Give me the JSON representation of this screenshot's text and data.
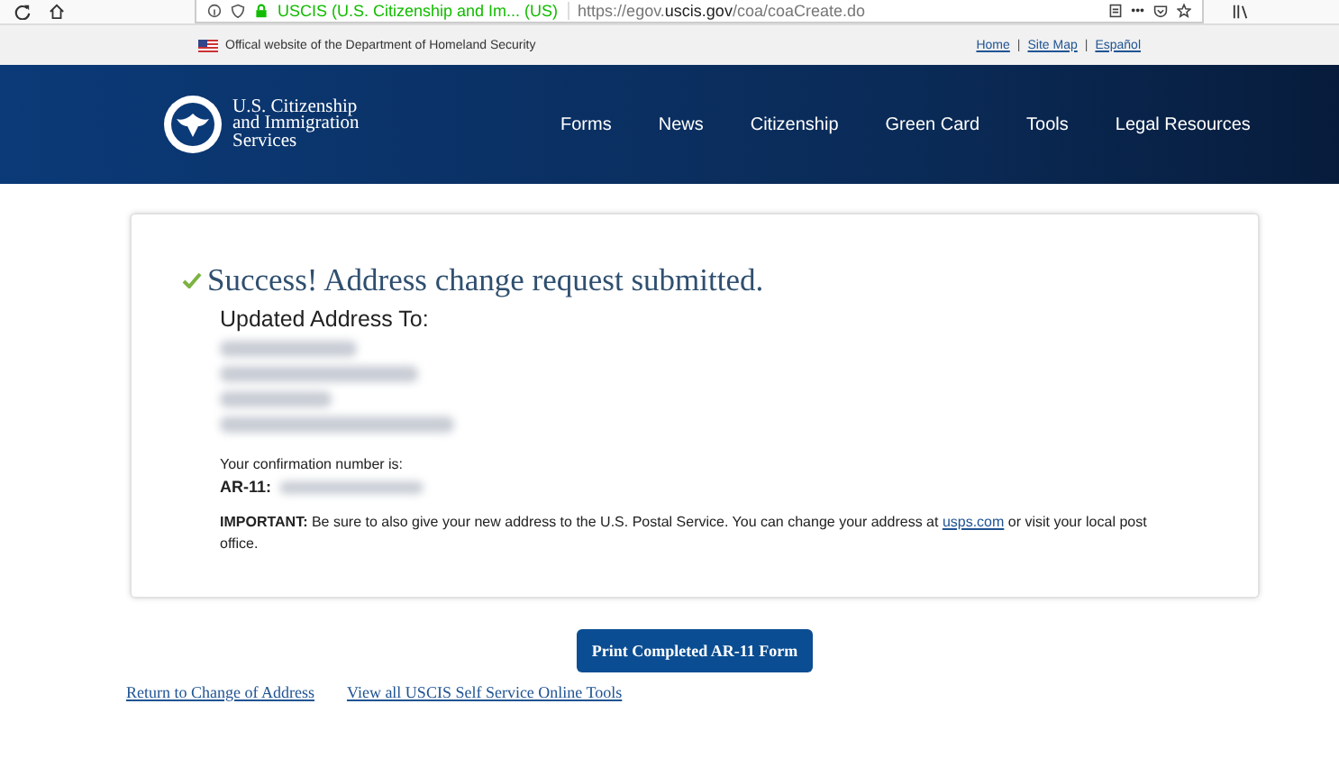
{
  "browser": {
    "site_identity": "USCIS (U.S. Citizenship and Im... (US)",
    "url_prefix": "https://egov.",
    "url_domain": "uscis.gov",
    "url_path": "/coa/coaCreate.do",
    "more": "•••"
  },
  "gov_banner": {
    "text": "Offical website of the Department of Homeland Security",
    "links": [
      "Home",
      "Site Map",
      "Español"
    ],
    "separator": "|"
  },
  "header": {
    "logo_text": [
      "U.S. Citizenship",
      "and Immigration",
      "Services"
    ],
    "nav": [
      "Forms",
      "News",
      "Citizenship",
      "Green Card",
      "Tools",
      "Legal Resources"
    ]
  },
  "result": {
    "title": "Success! Address change request submitted.",
    "address_label": "Updated Address To:",
    "redacted_lines": [
      {
        "kind": "redacted"
      },
      {
        "kind": "redacted"
      },
      {
        "kind": "redacted"
      },
      {
        "kind": "redacted"
      }
    ],
    "confirmation_label": "Your confirmation number is:",
    "ar11_label": "AR-11:",
    "important_prefix": "**IMPORTANT:** Be sure to also give your new address to the U.S. Postal Service. You can change your address at ",
    "important_link": "usps.com",
    "important_suffix": " or visit your local post office."
  },
  "print_button": "Print Completed AR-11 Form",
  "footer_links": [
    "Return to Change of Address",
    "View all USCIS Self Service Online Tools"
  ]
}
